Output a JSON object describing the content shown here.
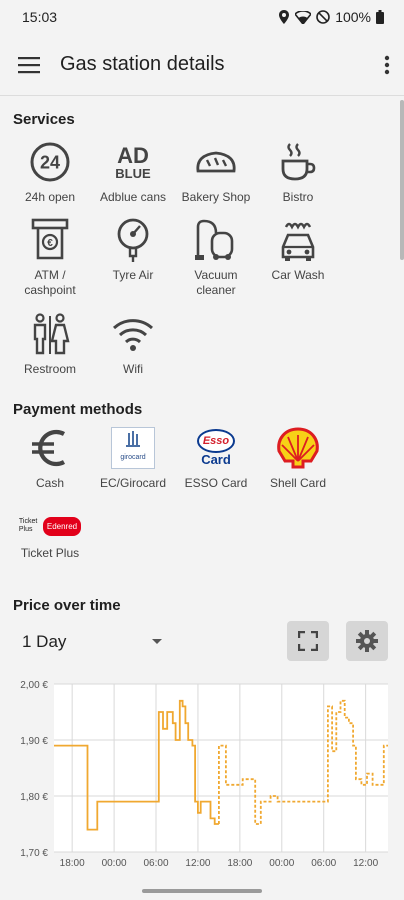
{
  "status": {
    "time": "15:03",
    "battery": "100%"
  },
  "appbar": {
    "title": "Gas station details",
    "menu_icon": "hamburger-menu-icon",
    "more_icon": "more-vert-icon"
  },
  "services": {
    "title": "Services",
    "items": [
      {
        "label": "24h open",
        "icon": "24h-icon"
      },
      {
        "label": "Adblue cans",
        "icon": "adblue-icon",
        "icon_text_1": "AD",
        "icon_text_2": "BLUE"
      },
      {
        "label": "Bakery Shop",
        "icon": "bread-icon"
      },
      {
        "label": "Bistro",
        "icon": "coffee-cup-icon"
      },
      {
        "label": "ATM / cashpoint",
        "icon": "atm-icon"
      },
      {
        "label": "Tyre Air",
        "icon": "tyre-gauge-icon"
      },
      {
        "label": "Vacuum cleaner",
        "icon": "vacuum-cleaner-icon"
      },
      {
        "label": "Car Wash",
        "icon": "car-wash-icon"
      },
      {
        "label": "Restroom",
        "icon": "restroom-icon"
      },
      {
        "label": "Wifi",
        "icon": "wifi-icon"
      }
    ]
  },
  "payment": {
    "title": "Payment methods",
    "items": [
      {
        "label": "Cash",
        "icon": "euro-icon"
      },
      {
        "label": "EC/Girocard",
        "icon": "girocard-logo",
        "logo_text": "girocard"
      },
      {
        "label": "ESSO Card",
        "icon": "esso-card-logo",
        "logo_text_1": "Esso",
        "logo_text_2": "Card"
      },
      {
        "label": "Shell Card",
        "icon": "shell-logo"
      },
      {
        "label": "Ticket Plus",
        "icon": "ticket-plus-logo",
        "logo_text_1": "Ticket Plus",
        "logo_text_2": "Edenred"
      }
    ]
  },
  "price": {
    "title": "Price over time",
    "range": "1 Day",
    "fullscreen_icon": "fullscreen-icon",
    "settings_icon": "settings-gear-icon"
  },
  "chart_data": {
    "type": "line",
    "title": "",
    "xlabel": "",
    "ylabel": "",
    "y_ticks": [
      "2,00 €",
      "1,90 €",
      "1,80 €",
      "1,70 €"
    ],
    "x_ticks": [
      "18:00",
      "00:00",
      "06:00",
      "12:00",
      "18:00",
      "00:00",
      "06:00",
      "12:00"
    ],
    "ylim": [
      1.7,
      2.0
    ],
    "x_unit": "hours (0 = first 18:00 tick)",
    "xlim": [
      -2.6,
      45.2
    ],
    "color": "#f0a830",
    "grid": true,
    "series": [
      {
        "style": "solid",
        "points": [
          [
            -2.6,
            1.89
          ],
          [
            2.2,
            1.89
          ],
          [
            2.2,
            1.74
          ],
          [
            3.6,
            1.74
          ],
          [
            3.6,
            1.79
          ],
          [
            12.4,
            1.79
          ],
          [
            12.4,
            1.95
          ],
          [
            13.0,
            1.95
          ],
          [
            13.0,
            1.92
          ],
          [
            13.6,
            1.92
          ],
          [
            13.6,
            1.95
          ],
          [
            14.4,
            1.95
          ],
          [
            14.4,
            1.93
          ],
          [
            14.8,
            1.93
          ],
          [
            14.8,
            1.9
          ],
          [
            15.4,
            1.9
          ],
          [
            15.4,
            1.97
          ],
          [
            15.8,
            1.97
          ],
          [
            15.8,
            1.96
          ],
          [
            16.2,
            1.96
          ],
          [
            16.2,
            1.93
          ],
          [
            16.6,
            1.93
          ],
          [
            16.6,
            1.9
          ],
          [
            17.2,
            1.9
          ],
          [
            17.2,
            1.89
          ],
          [
            17.6,
            1.89
          ],
          [
            17.6,
            1.79
          ],
          [
            18.0,
            1.79
          ],
          [
            18.0,
            1.77
          ],
          [
            18.4,
            1.77
          ],
          [
            18.4,
            1.79
          ],
          [
            19.8,
            1.79
          ],
          [
            19.8,
            1.76
          ],
          [
            20.4,
            1.76
          ],
          [
            20.4,
            1.75
          ],
          [
            21.0,
            1.75
          ]
        ]
      },
      {
        "style": "dashed",
        "points": [
          [
            21.0,
            1.75
          ],
          [
            21.0,
            1.89
          ],
          [
            22.0,
            1.89
          ],
          [
            22.0,
            1.82
          ],
          [
            24.4,
            1.82
          ],
          [
            24.4,
            1.83
          ],
          [
            26.2,
            1.83
          ],
          [
            26.2,
            1.75
          ],
          [
            27.0,
            1.75
          ],
          [
            27.0,
            1.79
          ],
          [
            28.4,
            1.79
          ],
          [
            28.4,
            1.8
          ],
          [
            29.4,
            1.8
          ],
          [
            29.4,
            1.79
          ],
          [
            36.6,
            1.79
          ],
          [
            36.6,
            1.96
          ],
          [
            37.2,
            1.96
          ],
          [
            37.2,
            1.88
          ],
          [
            37.8,
            1.88
          ],
          [
            37.8,
            1.95
          ],
          [
            38.4,
            1.95
          ],
          [
            38.4,
            1.97
          ],
          [
            39.0,
            1.97
          ],
          [
            39.0,
            1.94
          ],
          [
            39.6,
            1.94
          ],
          [
            39.6,
            1.93
          ],
          [
            40.2,
            1.93
          ],
          [
            40.2,
            1.89
          ],
          [
            40.6,
            1.89
          ],
          [
            40.6,
            1.83
          ],
          [
            41.4,
            1.83
          ],
          [
            41.4,
            1.82
          ],
          [
            42.2,
            1.82
          ],
          [
            42.2,
            1.84
          ],
          [
            43.0,
            1.84
          ],
          [
            43.0,
            1.82
          ],
          [
            44.6,
            1.82
          ],
          [
            44.6,
            1.89
          ],
          [
            45.2,
            1.89
          ]
        ]
      }
    ]
  }
}
